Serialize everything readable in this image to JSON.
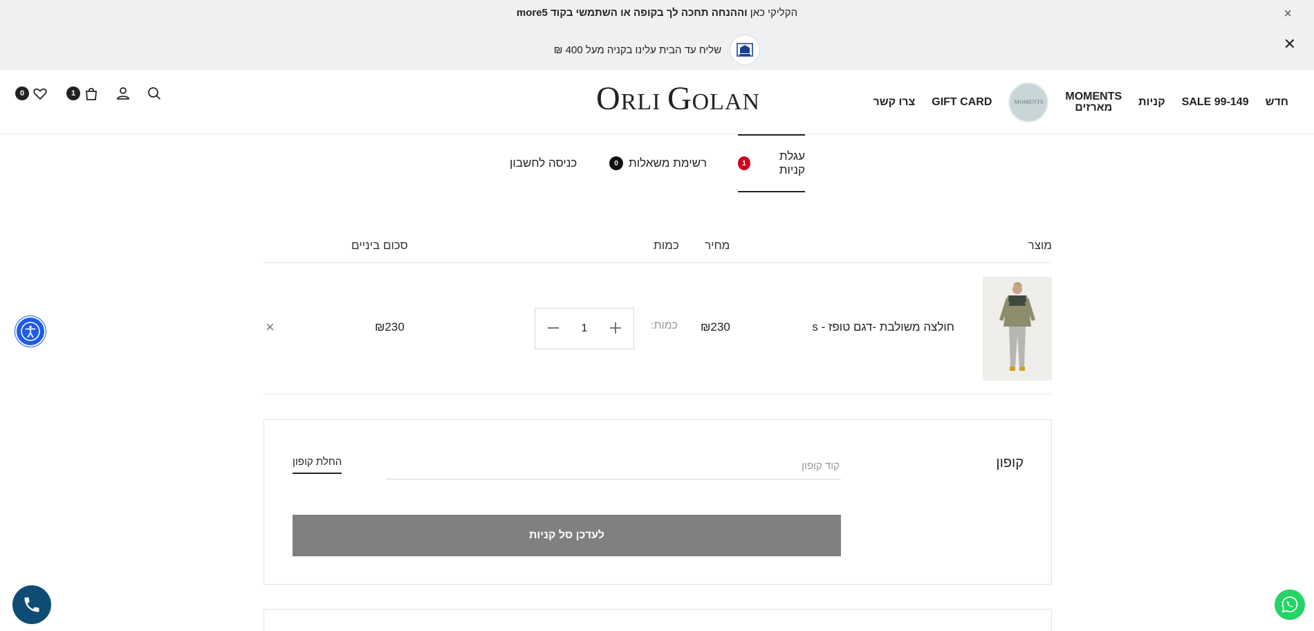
{
  "promo": {
    "line1_prefix": "הקליקי כאן",
    "line1_bold": "וההנחה תחכה לך בקופה או השתמשי בקוד more5",
    "line2": "שליח עד הבית עלינו בקניה מעל 400 ₪",
    "close1": "×",
    "close2": "✕",
    "badge_icon": "made-in-israel-badge-icon"
  },
  "header": {
    "logo_first_big": "O",
    "logo_first_rest": "RLI ",
    "logo_second_big": "G",
    "logo_second_rest": "OLAN",
    "nav": {
      "new": "חדש",
      "sale": "SALE 99-149",
      "shopping": "קניות",
      "moments_line1": "MOMENTS",
      "moments_line2": "מארזים",
      "moments_logo": "MOMENTS",
      "gift_card": "GIFT CARD",
      "contact": "צרו קשר"
    },
    "wishlist_count": "0",
    "cart_count": "1"
  },
  "tabs": {
    "cart_label": "עגלת קניות",
    "cart_count": "1",
    "wishlist_label": "רשימת משאלות",
    "wishlist_count": "0",
    "login_label": "כניסה לחשבון"
  },
  "cart": {
    "columns": {
      "product": "מוצר",
      "price": "מחיר",
      "quantity": "כמות",
      "subtotal": "סכום ביניים"
    },
    "items": [
      {
        "name": "חולצה משולבת -דגם טופז - s",
        "price": "₪230",
        "qty_label": "כמות:",
        "quantity": "1",
        "subtotal": "₪230",
        "remove": "×"
      }
    ]
  },
  "coupon": {
    "title": "קופון",
    "placeholder": "קוד קופון",
    "apply_label": "החלת קופון",
    "update_label": "לעדכן סל קניות"
  },
  "colors": {
    "topbar_bg": "#eef0f2",
    "cart_badge": "#d0021b",
    "update_button": "#808080",
    "a11y": "#1e5be6",
    "phone": "#0e4c73",
    "whatsapp": "#25d366"
  }
}
